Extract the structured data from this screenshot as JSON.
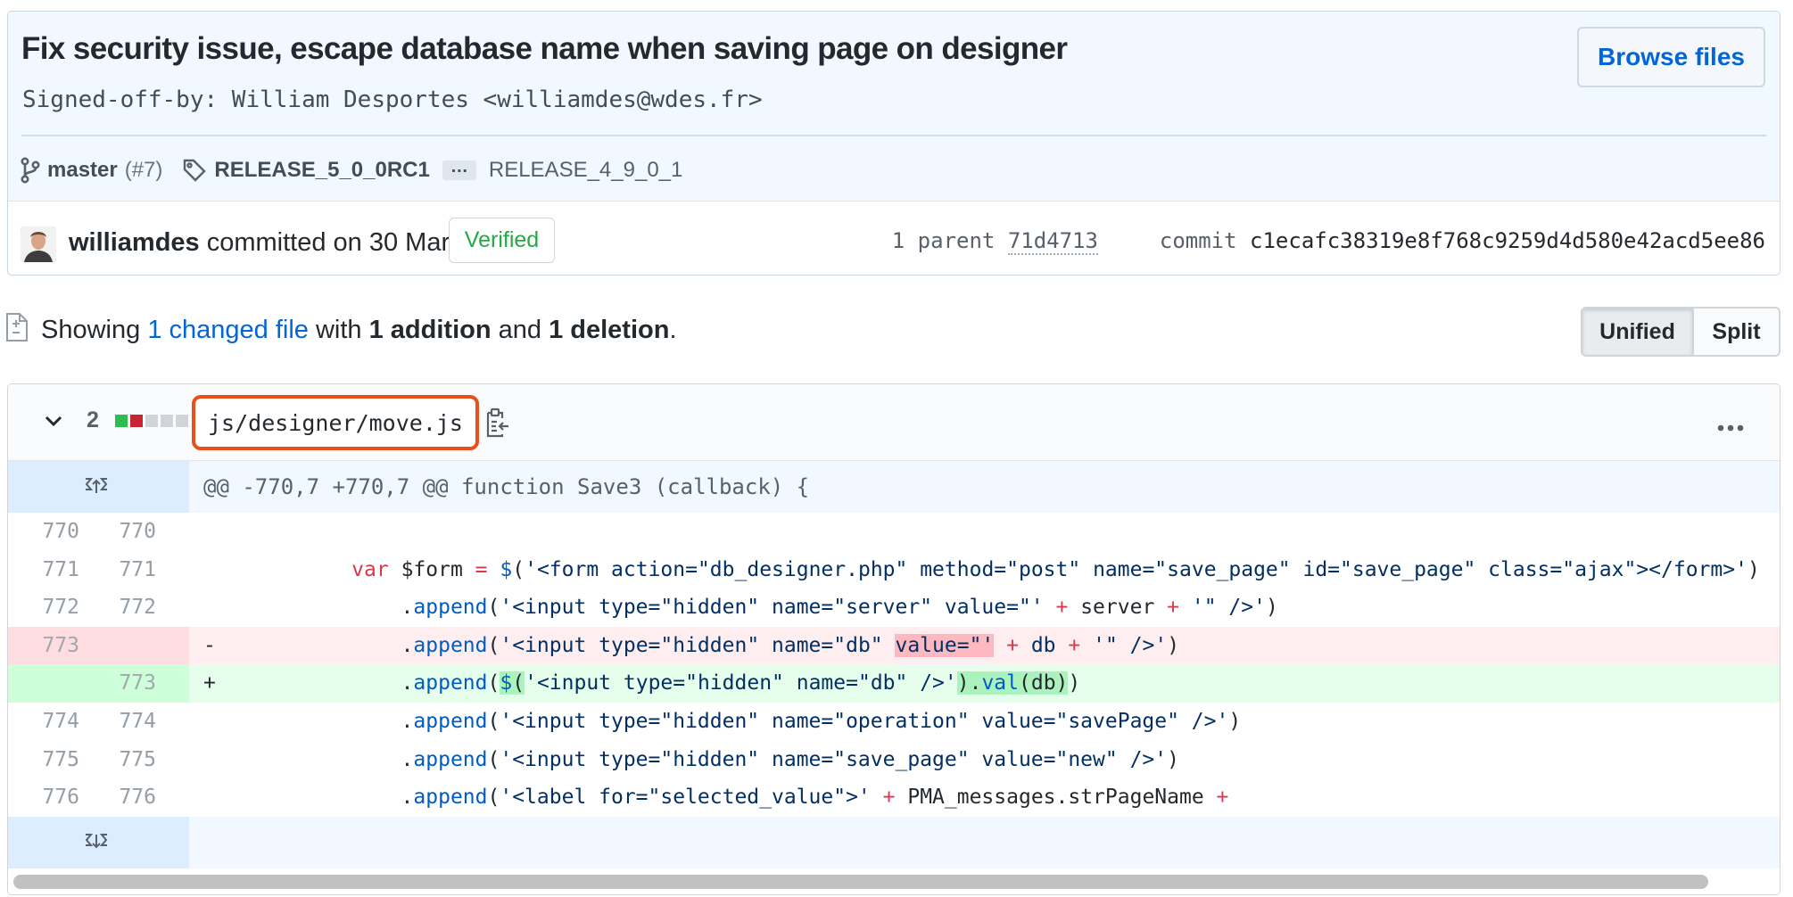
{
  "commit": {
    "title": "Fix security issue, escape database name when saving page on designer",
    "description": "Signed-off-by: William Desportes <williamdes@wdes.fr>",
    "browse_files_label": "Browse files",
    "branch": "master",
    "branch_pr": "(#7)",
    "tag_primary": "RELEASE_5_0_0RC1",
    "tags_more_label": "…",
    "tag_secondary": "RELEASE_4_9_0_1",
    "author": "williamdes",
    "committed_text": "committed on 30 Mar",
    "verified_label": "Verified",
    "parent_count_label": "1 parent",
    "parent_sha": "71d4713",
    "commit_label": "commit",
    "commit_sha": "c1ecafc38319e8f768c9259d4d580e42acd5ee86"
  },
  "toc": {
    "showing": "Showing",
    "changed_link": "1 changed file",
    "with": "with",
    "additions": "1 addition",
    "and": "and",
    "deletions": "1 deletion",
    "period": ".",
    "unified_label": "Unified",
    "split_label": "Split"
  },
  "file": {
    "changes_count": "2",
    "diffstat": [
      "add",
      "del",
      "neutral",
      "neutral",
      "neutral"
    ],
    "path": "js/designer/move.js",
    "hunk_header": "@@ -770,7 +770,7 @@ function Save3 (callback) {",
    "lines": [
      {
        "old": "770",
        "new": "770",
        "type": "context"
      },
      {
        "old": "771",
        "new": "771",
        "type": "context"
      },
      {
        "old": "772",
        "new": "772",
        "type": "context"
      },
      {
        "old": "773",
        "new": "",
        "type": "del",
        "marker": "-"
      },
      {
        "old": "",
        "new": "773",
        "type": "add",
        "marker": "+"
      },
      {
        "old": "774",
        "new": "774",
        "type": "context"
      },
      {
        "old": "775",
        "new": "775",
        "type": "context"
      },
      {
        "old": "776",
        "new": "776",
        "type": "context"
      }
    ]
  },
  "icons": {
    "branch": "git-branch-icon",
    "tag": "tag-icon",
    "collapse": "chevron-down-icon",
    "clipboard": "clipboard-icon",
    "more": "kebab-horizontal-icon",
    "expand_up": "expand-up-icon",
    "expand_down": "expand-down-icon",
    "diff_file": "file-diff-icon"
  },
  "colors": {
    "link": "#0366d6",
    "verified": "#28a745",
    "highlight_border": "#e8501a",
    "addition_bg": "#e6ffed",
    "deletion_bg": "#ffeef0"
  }
}
